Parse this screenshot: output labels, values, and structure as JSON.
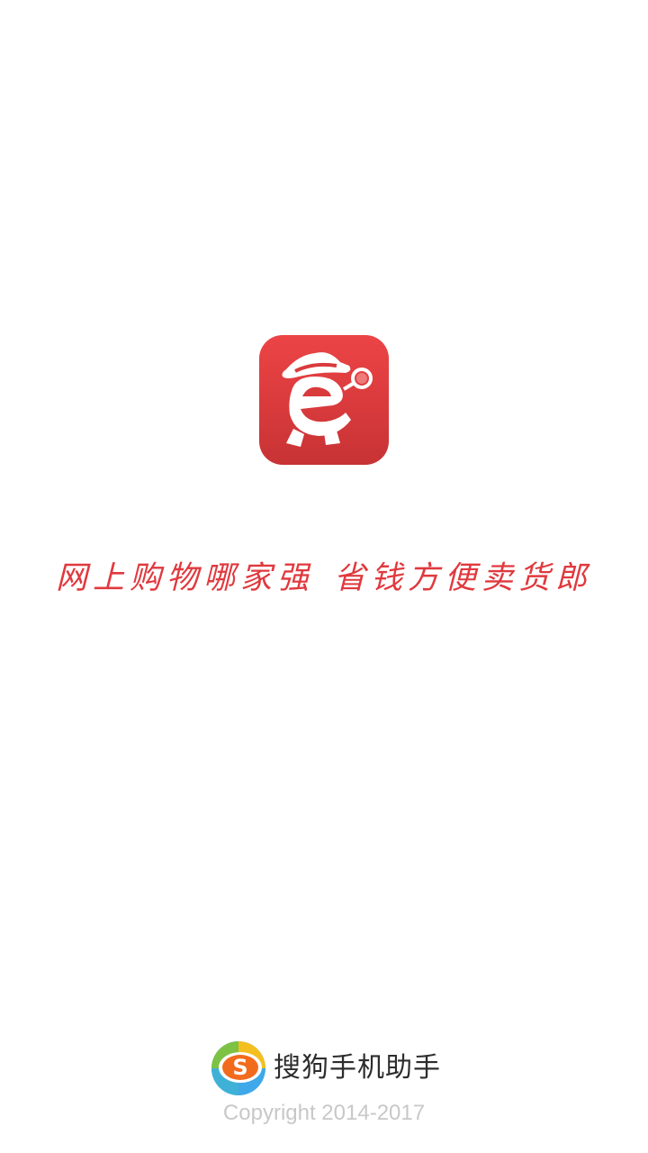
{
  "splash": {
    "slogan_left": "网上购物哪家强",
    "slogan_right": "省钱方便卖货郎",
    "brand_color": "#e0393e"
  },
  "footer": {
    "brand_name": "搜狗手机助手",
    "brand_icon": "sogou-logo-icon",
    "copyright": "Copyright 2014-2017"
  }
}
